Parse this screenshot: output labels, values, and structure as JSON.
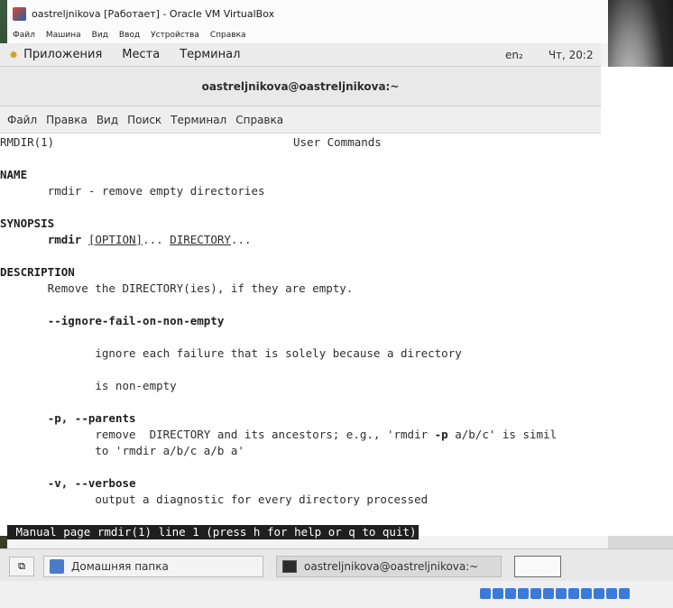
{
  "vbox": {
    "title": "oastreljnikova [Работает] - Oracle VM VirtualBox",
    "menu": [
      "Файл",
      "Машина",
      "Вид",
      "Ввод",
      "Устройства",
      "Справка"
    ]
  },
  "gnome_panel": {
    "apps": "Приложения",
    "places": "Места",
    "terminal": "Терминал",
    "keyboard": "en₂",
    "clock": "Чт, 20:2"
  },
  "terminal": {
    "title": "oastreljnikova@oastreljnikova:~",
    "menu": [
      "Файл",
      "Правка",
      "Вид",
      "Поиск",
      "Терминал",
      "Справка"
    ],
    "man": {
      "header_left": "RMDIR(1)",
      "header_center": "User Commands",
      "name_heading": "NAME",
      "name_text": "       rmdir - remove empty directories",
      "synopsis_heading": "SYNOPSIS",
      "synopsis_indent": "       ",
      "synopsis_cmd": "rmdir",
      "synopsis_sp": " ",
      "synopsis_opt": "[OPTION]",
      "synopsis_dots": "... ",
      "synopsis_dir": "DIRECTORY",
      "synopsis_end": "...",
      "description_heading": "DESCRIPTION",
      "description_text": "       Remove the DIRECTORY(ies), if they are empty.",
      "opt1_indent": "       ",
      "opt1": "--ignore-fail-on-non-empty",
      "opt1_text1": "              ignore each failure that is solely because a directory",
      "opt1_text2": "              is non-empty",
      "opt2_pre": "       ",
      "opt2": "-p, --parents",
      "opt2_text1a": "              remove  DIRECTORY and its ancestors; e.g., 'rmdir ",
      "opt2_text1b": "-p",
      "opt2_text1c": " a/b/c' is simil",
      "opt2_text2": "              to 'rmdir a/b/c a/b a'",
      "opt3_pre": "       ",
      "opt3": "-v, --verbose",
      "opt3_text": "              output a diagnostic for every directory processed",
      "status": " Manual page rmdir(1) line 1 (press h for help or q to quit)"
    }
  },
  "taskbar": {
    "home_folder": "Домашняя папка",
    "terminal_task": "oastreljnikova@oastreljnikova:~"
  }
}
